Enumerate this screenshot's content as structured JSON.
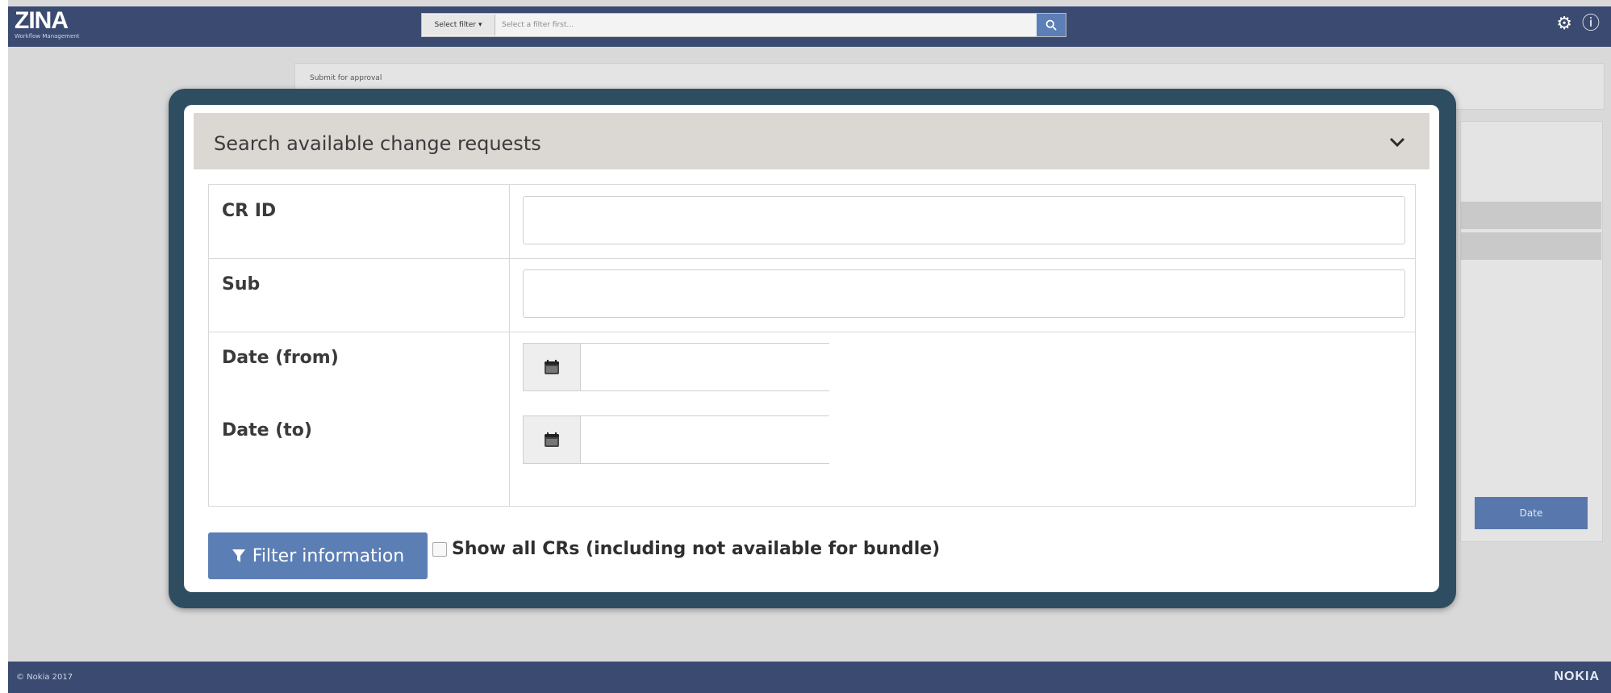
{
  "app": {
    "name": "ZINA",
    "subtitle": "Workflow Management"
  },
  "topbar": {
    "filter_select_label": "Select filter ▾",
    "filter_placeholder": "Select a filter first...",
    "search_icon": "search-icon",
    "settings_icon": "gear-icon",
    "info_icon": "info-icon"
  },
  "background": {
    "submit_label": "Submit for approval",
    "date_button": "Date"
  },
  "modal": {
    "title": "Search available change requests",
    "fields": {
      "cr_id": "CR ID",
      "sub": "Sub",
      "date_from": "Date (from)",
      "date_to": "Date (to)"
    },
    "filter_button": "Filter information",
    "show_all_label": "Show all CRs (including not available for bundle)"
  },
  "footer": {
    "copyright": "© Nokia 2017",
    "brand": "NOKIA"
  },
  "colors": {
    "header": "#3a4a70",
    "accent": "#5b7eb5",
    "modal_header": "#dbd7d3"
  }
}
